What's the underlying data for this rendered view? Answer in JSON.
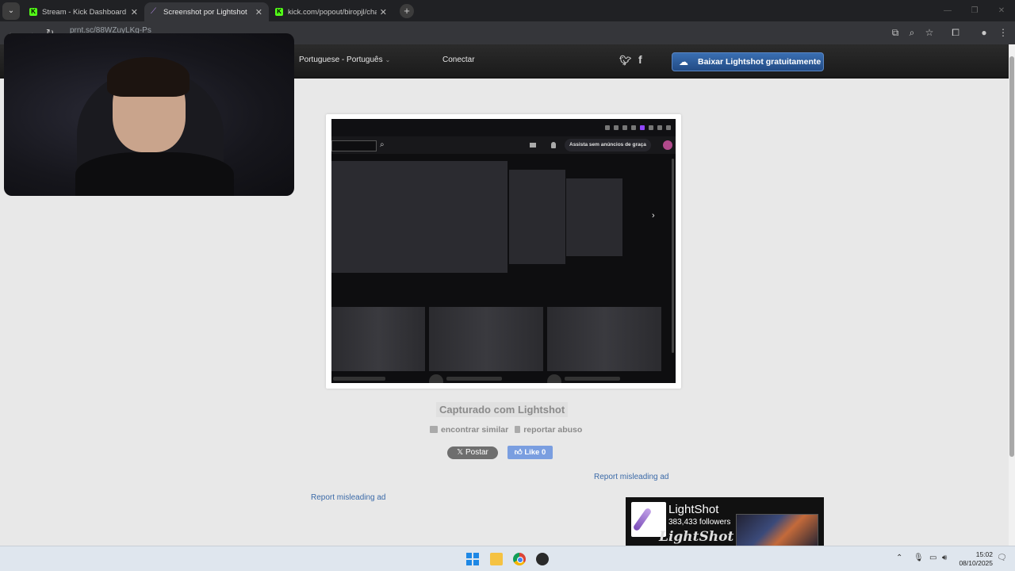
{
  "browser": {
    "tabs": [
      {
        "title": "Stream - Kick Dashboard",
        "active": false
      },
      {
        "title": "Screenshot por Lightshot",
        "active": true
      },
      {
        "title": "kick.com/popout/biropjl/chat",
        "active": false
      }
    ],
    "url": "prnt.sc/88WZuyLKg-Ps"
  },
  "lightshot": {
    "language": "Portuguese - Português",
    "connect": "Conectar",
    "download_button": "Baixar Lightshot gratuitamente",
    "captured": "Capturado com Lightshot",
    "find_similar": "encontrar similar",
    "report_abuse": "reportar abuso",
    "post_button": "Postar",
    "like_button": "Like",
    "like_count": "0",
    "report_ad_1": "Report misleading ad",
    "report_ad_2": "Report misleading ad",
    "ad": {
      "name": "LightShot",
      "followers": "383,433 followers",
      "script_text": "LightShot"
    }
  },
  "screenshot": {
    "ads_text": "Assista sem anúncios de graça"
  },
  "taskbar": {
    "time": "15:02",
    "date": "08/10/2025"
  }
}
